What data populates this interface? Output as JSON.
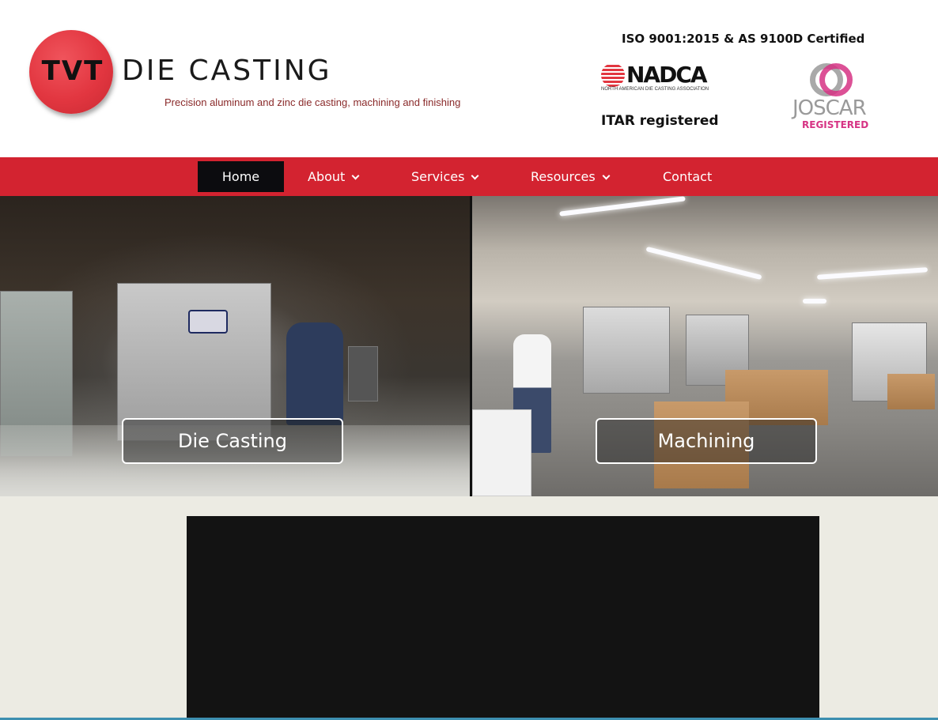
{
  "header": {
    "logo_mark": "TVT",
    "logo_name": "DIE CASTING",
    "tagline": "Precision aluminum and zinc die casting, machining and finishing",
    "certification": "ISO 9001:2015 & AS 9100D Certified",
    "nadca": {
      "name": "NADCA",
      "subtitle": "NORTH AMERICAN DIE CASTING ASSOCIATION"
    },
    "itar": "ITAR registered",
    "joscar": {
      "name": "JOSCAR",
      "label": "REGISTERED"
    }
  },
  "nav": {
    "items": [
      {
        "label": "Home",
        "active": true,
        "dropdown": false
      },
      {
        "label": "About",
        "active": false,
        "dropdown": true
      },
      {
        "label": "Services",
        "active": false,
        "dropdown": true
      },
      {
        "label": "Resources",
        "active": false,
        "dropdown": true
      },
      {
        "label": "Contact",
        "active": false,
        "dropdown": false
      }
    ]
  },
  "hero": {
    "left": {
      "button_label": "Die Casting",
      "image": "die-casting-machine-photo"
    },
    "right": {
      "button_label": "Machining",
      "image": "machining-shop-floor-photo"
    }
  },
  "colors": {
    "brand_red": "#d32330",
    "nav_active": "#0c0c0f",
    "joscar_pink": "#d63384",
    "page_bg": "#ecebe3"
  }
}
